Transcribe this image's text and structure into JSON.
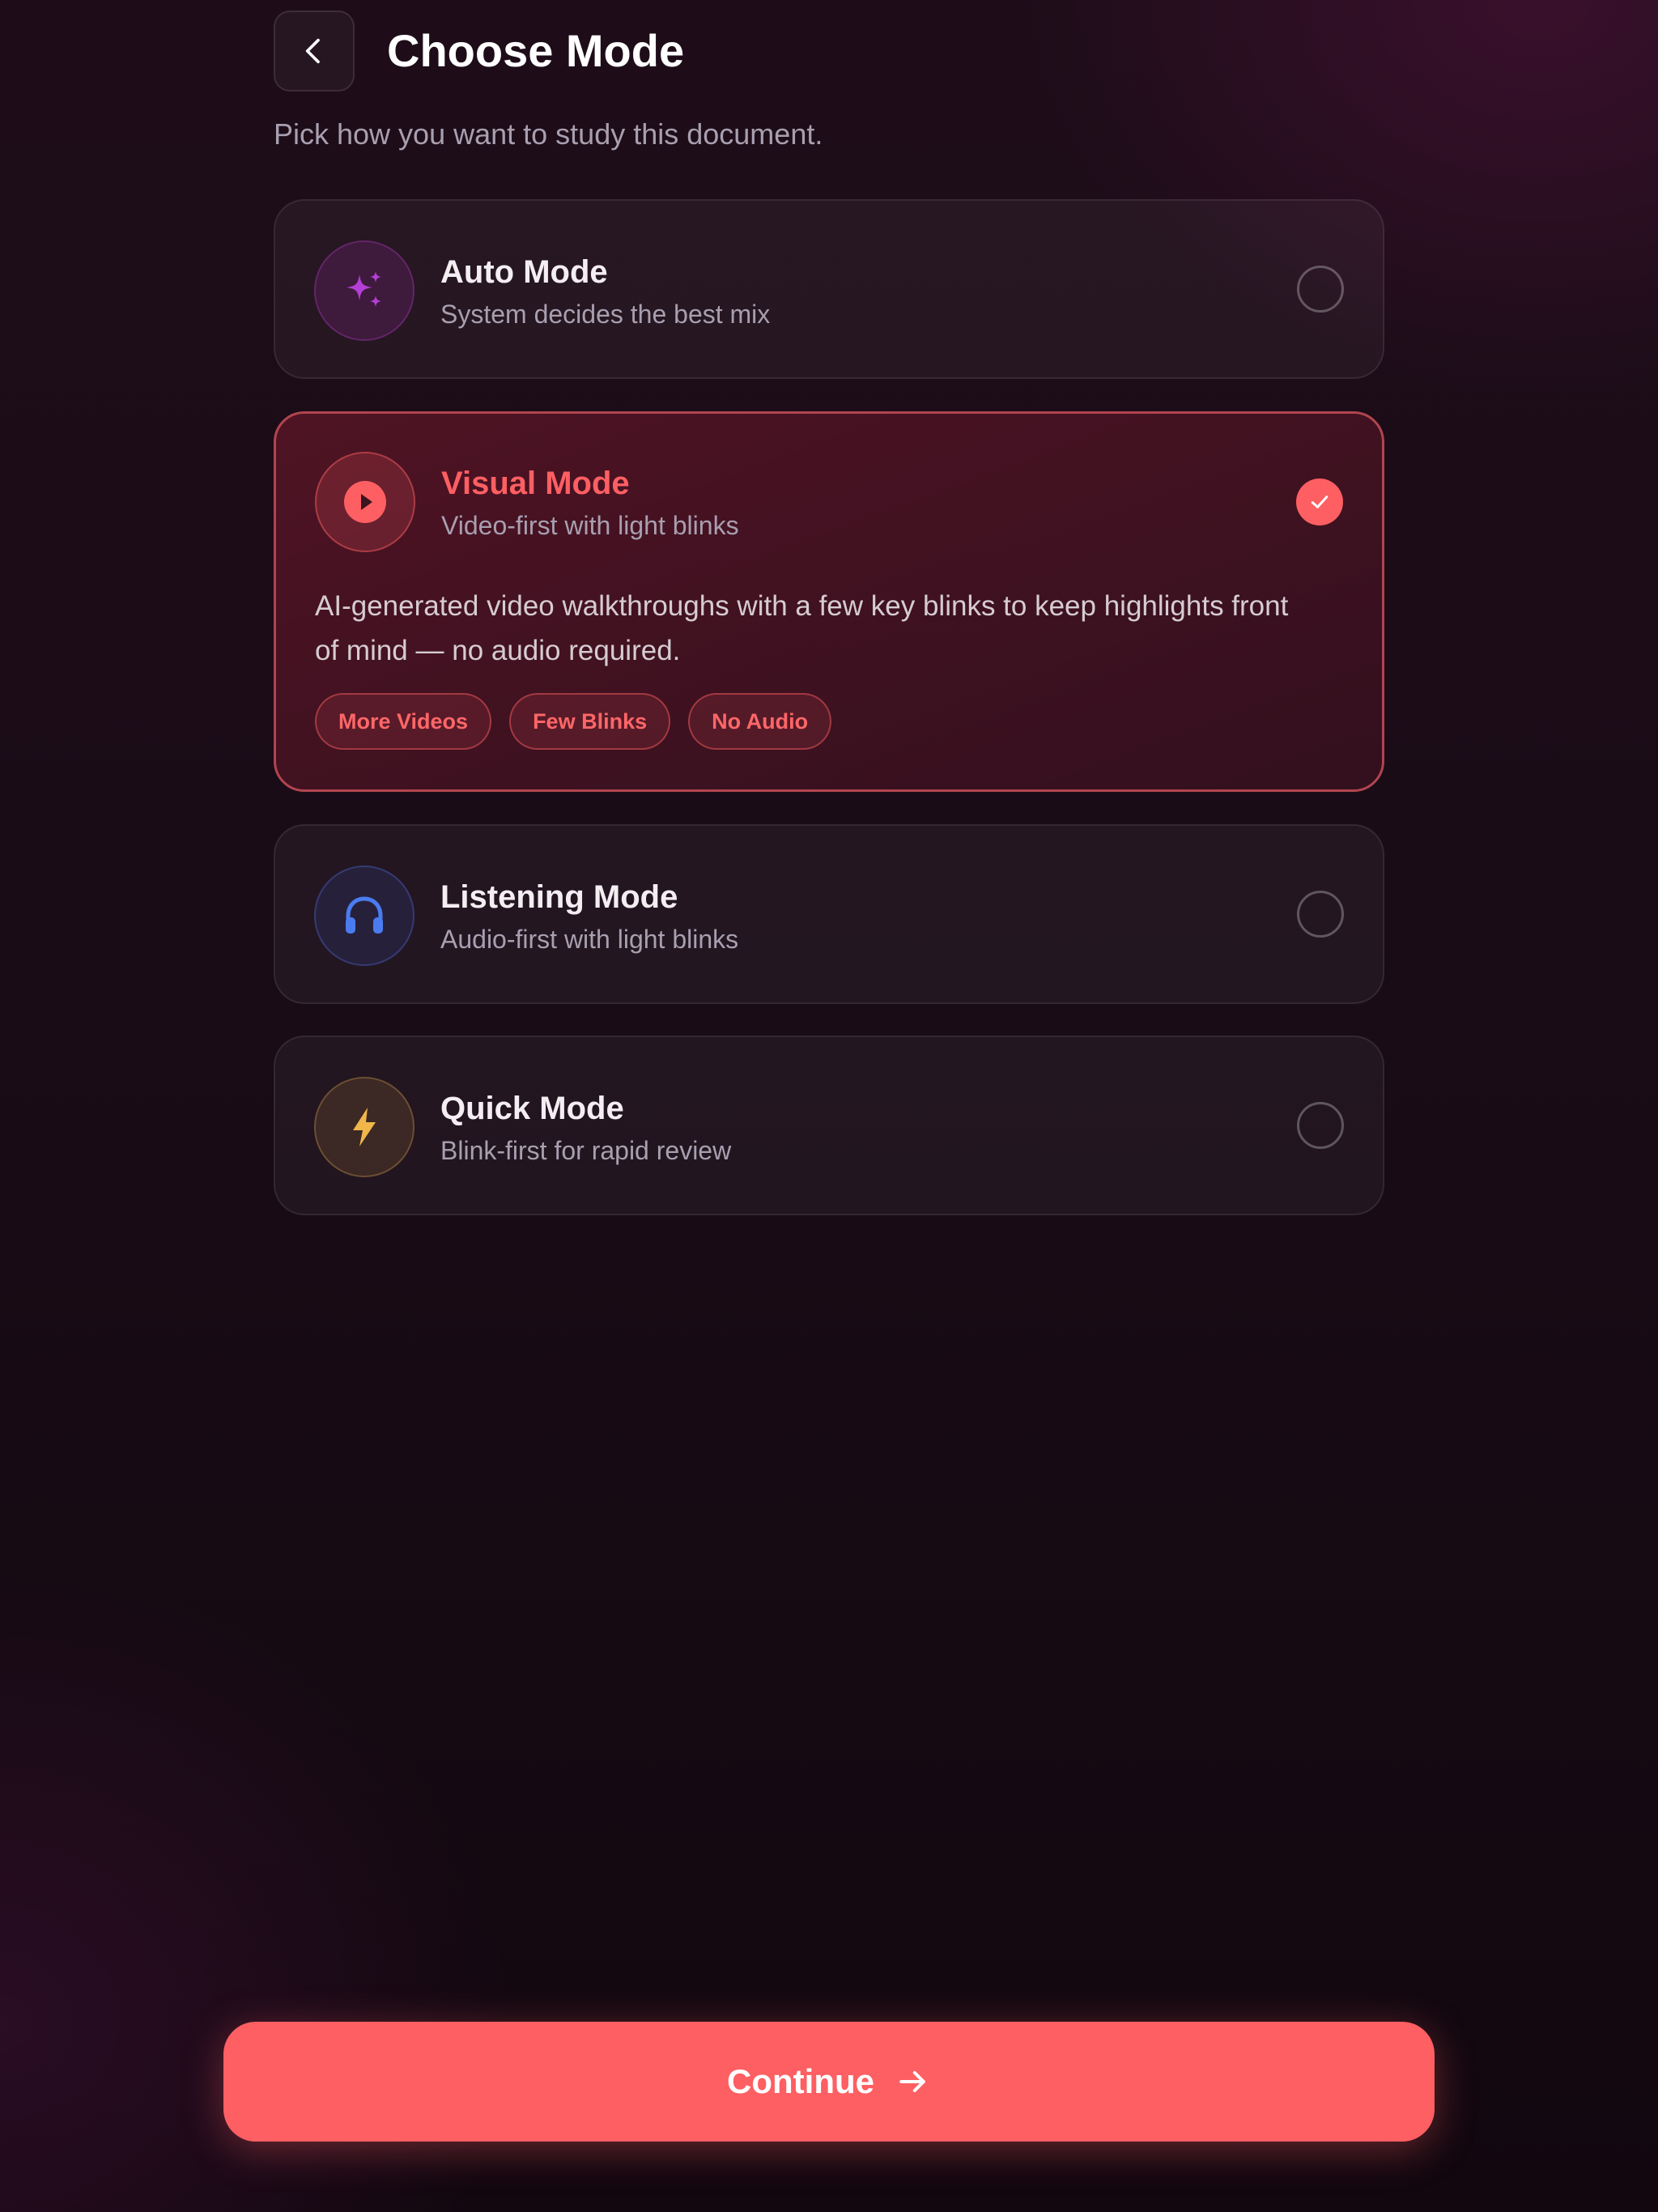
{
  "header": {
    "title": "Choose Mode",
    "subtitle": "Pick how you want to study this document."
  },
  "modes": [
    {
      "title": "Auto Mode",
      "description": "System decides the best mix",
      "icon": "sparkles-icon",
      "accent": "#b43fd6",
      "selected": false
    },
    {
      "title": "Visual Mode",
      "description": "Video-first with light blinks",
      "icon": "play-icon",
      "accent": "#fe5f62",
      "selected": true,
      "details": "AI-generated video walkthroughs with a few key blinks to keep highlights front of mind — no audio required.",
      "tags": [
        "More Videos",
        "Few Blinks",
        "No Audio"
      ]
    },
    {
      "title": "Listening Mode",
      "description": "Audio-first with light blinks",
      "icon": "headphones-icon",
      "accent": "#4a7cf0",
      "selected": false
    },
    {
      "title": "Quick Mode",
      "description": "Blink-first for rapid review",
      "icon": "lightning-icon",
      "accent": "#f0b64a",
      "selected": false
    }
  ],
  "footer": {
    "continue_label": "Continue"
  },
  "colors": {
    "primary": "#fe5f62",
    "background": "#1a0c17"
  }
}
